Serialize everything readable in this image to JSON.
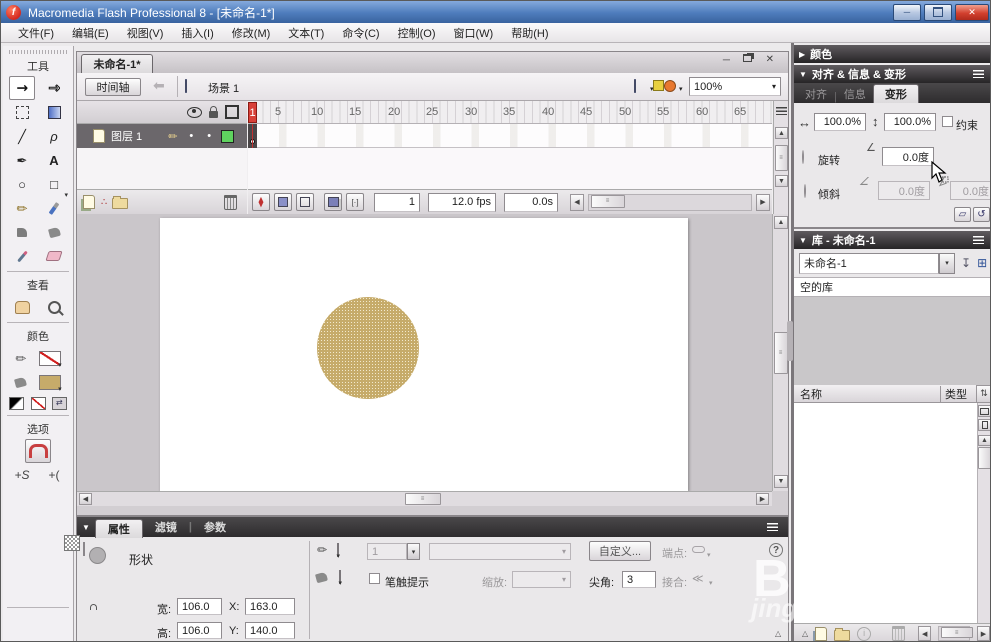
{
  "titlebar": {
    "title": "Macromedia Flash Professional 8 - [未命名-1*]"
  },
  "icons": {
    "minimize": "─",
    "close": "✕",
    "dropdown": "▼",
    "small_arrow": "▾",
    "collapsed": "▶",
    "expanded": "▼",
    "back_arrow": "⬅",
    "join": "≪",
    "up": "▲",
    "down": "▼",
    "left": "◀",
    "right": "▶",
    "grip": "≡"
  },
  "menubar": {
    "items": [
      "文件(F)",
      "编辑(E)",
      "视图(V)",
      "插入(I)",
      "修改(M)",
      "文本(T)",
      "命令(C)",
      "控制(O)",
      "窗口(W)",
      "帮助(H)"
    ]
  },
  "toolbox": {
    "tools_title": "工具",
    "view_title": "查看",
    "colors_title": "颜色",
    "options_title": "选项",
    "text_tool_glyph": "A",
    "line_glyph": "╱",
    "lasso_glyph": "ρ",
    "pen_glyph": "✒",
    "oval_glyph": "○",
    "rect_glyph": "□",
    "pencil_glyph": "✏",
    "select_glyph": "↖",
    "subselect_glyph": "↖",
    "smooth_label": "+S",
    "straighten_label": "+(",
    "stroke_color": "none",
    "fill_color": "#c6ab6a"
  },
  "document": {
    "tab_label": "未命名-1*",
    "timeline_button": "时间轴",
    "scene_label": "场景 1",
    "zoom_value": "100%",
    "timeline": {
      "layer_name": "图层 1",
      "playhead_label": "1",
      "ruler": [
        "5",
        "10",
        "15",
        "20",
        "25",
        "30",
        "35",
        "40",
        "45",
        "50",
        "55",
        "60",
        "65"
      ],
      "current_frame": "1",
      "frame_rate": "12.0 fps",
      "elapsed_time": "0.0s"
    },
    "stage": {
      "shape": "circle",
      "shape_fill": "#c6ab6a"
    }
  },
  "properties": {
    "tab_properties": "属性",
    "tab_filters": "滤镜",
    "tab_parameters": "参数",
    "object_type": "形状",
    "width_label": "宽:",
    "width_value": "106.0",
    "x_label": "X:",
    "x_value": "163.0",
    "height_label": "高:",
    "height_value": "106.0",
    "y_label": "Y:",
    "y_value": "140.0",
    "stroke_height_value": "1",
    "stroke_hint_label": "笔触提示",
    "scale_label": "缩放:",
    "custom_button_label": "自定义...",
    "cap_label": "端点:",
    "miter_label": "尖角:",
    "miter_value": "3",
    "join_label": "接合:"
  },
  "panels": {
    "color_title": "颜色",
    "ait": {
      "title": "对齐 & 信息 & 变形",
      "tab_align": "对齐",
      "tab_info": "信息",
      "tab_transform": "变形",
      "scale_x": "100.0%",
      "scale_y": "100.0%",
      "constrain_label": "约束",
      "rotate_label": "旋转",
      "rotate_value": "0.0度",
      "skew_label": "倾斜",
      "skew_x_value": "0.0度",
      "skew_y_value": "0.0度"
    },
    "library": {
      "title": "库 - 未命名-1",
      "doc_dropdown_value": "未命名-1",
      "empty_label": "空的库",
      "col_name": "名称",
      "col_type": "类型"
    }
  },
  "watermark": {
    "letter": "B",
    "text": "jing"
  }
}
